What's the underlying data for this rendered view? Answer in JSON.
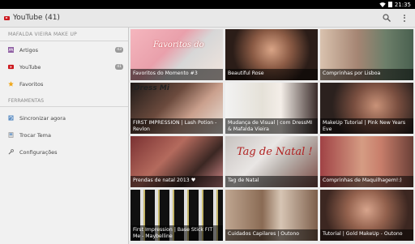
{
  "status": {
    "time": "21:35"
  },
  "actionbar": {
    "title": "YouTube (41)"
  },
  "drawer": {
    "header": "MAFALDA VIEIRA MAKE UP",
    "items": [
      {
        "label": "Artigos",
        "icon": "articles-icon",
        "count": "43"
      },
      {
        "label": "YouTube",
        "icon": "youtube-icon",
        "count": "41"
      },
      {
        "label": "Favoritos",
        "icon": "star-icon",
        "count": ""
      }
    ],
    "tools_header": "FERRAMENTAS",
    "tools": [
      {
        "label": "Sincronizar agora",
        "icon": "sync-icon"
      },
      {
        "label": "Trocar Tema",
        "icon": "theme-icon"
      },
      {
        "label": "Configurações",
        "icon": "settings-icon"
      }
    ]
  },
  "videos": [
    {
      "title": "Favoritos do Momento #3",
      "overlay": "Favoritos do"
    },
    {
      "title": "Beautiful Rose"
    },
    {
      "title": "Comprinhas por Lisboa"
    },
    {
      "title": "FIRST IMPRESSION | Lash Potion - Revlon",
      "overlay": "Dress Mi"
    },
    {
      "title": "Mudança de Visual | com DressMI & Mafalda Vieira"
    },
    {
      "title": "MakeUp Tutorial | Pink New Years Eve"
    },
    {
      "title": "Prendas de natal 2013 ♥"
    },
    {
      "title": "Tag de Natal",
      "overlay": "Tag de Natal !"
    },
    {
      "title": "Comprinhas de Maquilhagem!:)"
    },
    {
      "title": "First Impression | Base Stick FIT Me - Maybelline"
    },
    {
      "title": "Cuidados Capilares | Outono"
    },
    {
      "title": "Tutorial | Gold MakeUp - Outono"
    }
  ]
}
